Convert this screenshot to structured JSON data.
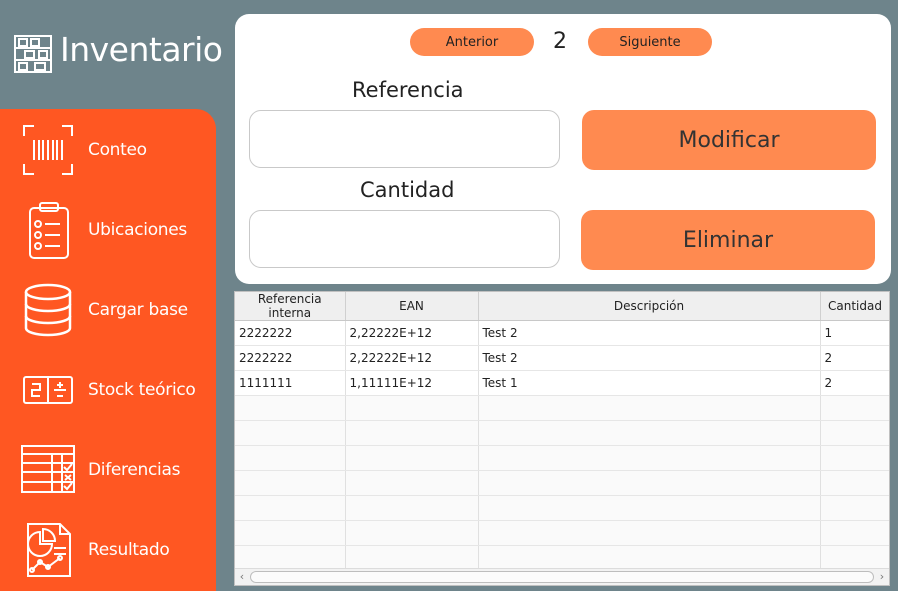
{
  "app": {
    "title": "Inventario"
  },
  "sidebar": {
    "items": [
      {
        "label": "Conteo",
        "icon": "barcode-scan-icon"
      },
      {
        "label": "Ubicaciones",
        "icon": "clipboard-list-icon"
      },
      {
        "label": "Cargar base",
        "icon": "database-icon"
      },
      {
        "label": "Stock teórico",
        "icon": "calculator-icon"
      },
      {
        "label": "Diferencias",
        "icon": "spreadsheet-check-icon"
      },
      {
        "label": "Resultado",
        "icon": "report-chart-icon"
      }
    ]
  },
  "pager": {
    "prev_label": "Anterior",
    "page": "2",
    "next_label": "Siguiente"
  },
  "form": {
    "referencia_label": "Referencia",
    "referencia_value": "",
    "cantidad_label": "Cantidad",
    "cantidad_value": "",
    "modificar_label": "Modificar",
    "eliminar_label": "Eliminar"
  },
  "table": {
    "columns": [
      "Referencia interna",
      "EAN",
      "Descripción",
      "Cantidad"
    ],
    "rows": [
      [
        "2222222",
        "2,22222E+12",
        "Test 2",
        "1"
      ],
      [
        "2222222",
        "2,22222E+12",
        "Test 2",
        "2"
      ],
      [
        "1111111",
        "1,11111E+12",
        "Test 1",
        "2"
      ]
    ]
  },
  "colors": {
    "accent": "#ff5722",
    "button": "#ff8a50",
    "background": "#6e848b"
  }
}
